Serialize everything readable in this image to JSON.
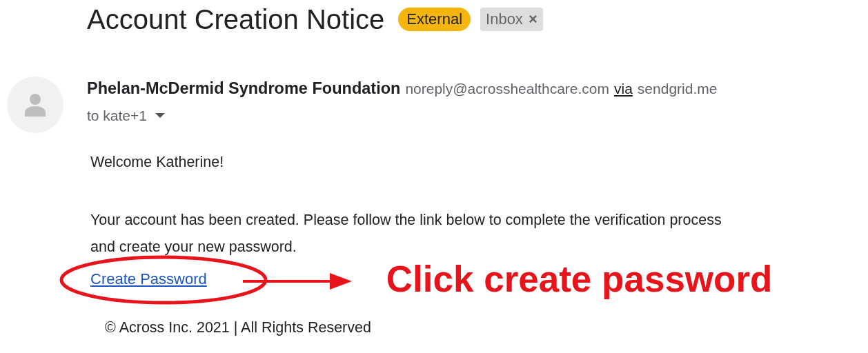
{
  "subject": "Account Creation Notice",
  "labels": [
    {
      "text": "External",
      "kind": "external"
    },
    {
      "text": "Inbox",
      "kind": "folder",
      "close": "×"
    }
  ],
  "sender": {
    "name": "Phelan-McDermid Syndrome Foundation",
    "email": "noreply@acrosshealthcare.com",
    "via": "via",
    "via_host": "sendgrid.me"
  },
  "recipients": "to kate+1",
  "body": {
    "greeting": "Welcome Katherine!",
    "paragraph": "Your account has been created. Please follow the link below to complete the verification process and create your new password.",
    "link": "Create Password"
  },
  "annotation": "Click create password",
  "footer": "© Across Inc. 2021 | All Rights Reserved"
}
